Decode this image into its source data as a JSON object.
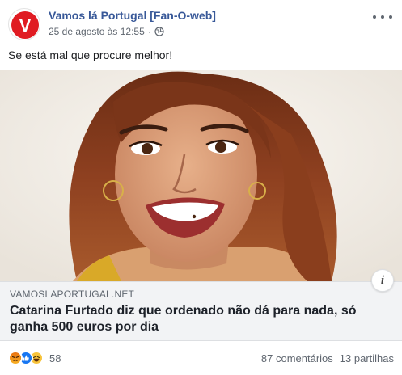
{
  "post": {
    "page_name": "Vamos lá Portugal [Fan-O-web]",
    "timestamp": "25 de agosto às 12:55",
    "separator": "·",
    "privacy_icon": "globe-icon",
    "avatar_letter": "V",
    "message": "Se está mal que procure melhor!"
  },
  "link": {
    "domain": "VAMOSLAPORTUGAL.NET",
    "headline": "Catarina Furtado diz que ordenado não dá para nada, só ganha 500 euros por dia",
    "info_label": "i"
  },
  "footer": {
    "reaction_icons": [
      "angry-icon",
      "like-icon",
      "haha-icon"
    ],
    "reaction_count": "58",
    "comments": "87 comentários",
    "shares": "13 partilhas"
  },
  "colors": {
    "brand_red": "#e01b22",
    "link_blue": "#385898",
    "meta_gray": "#606770"
  }
}
